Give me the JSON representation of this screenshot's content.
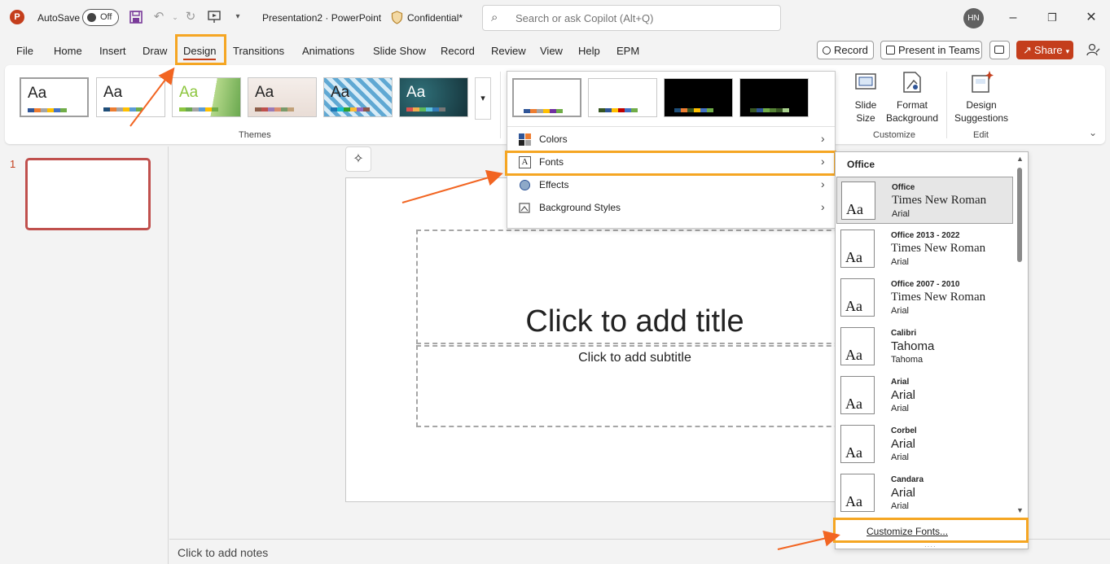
{
  "titlebar": {
    "app_logo": "P",
    "autosave_label": "AutoSave",
    "autosave_state": "Off",
    "document_title": "Presentation2  ·  PowerPoint",
    "sensitivity_label": "Confidential*",
    "search_placeholder": "Search or ask Copilot (Alt+Q)",
    "user_initials": "HN",
    "icons": [
      "save-icon",
      "undo-icon",
      "redo-icon",
      "present-icon",
      "customize-qat-icon",
      "minimize-icon",
      "restore-icon",
      "close-icon"
    ]
  },
  "menu": {
    "tabs": [
      "File",
      "Home",
      "Insert",
      "Draw",
      "Design",
      "Transitions",
      "Animations",
      "Slide Show",
      "Record",
      "Review",
      "View",
      "Help",
      "EPM"
    ],
    "active_tab": "Design",
    "record_button": "Record",
    "present_teams_button": "Present in Teams",
    "share_button": "Share"
  },
  "ribbon": {
    "themes_group_label": "Themes",
    "themes": [
      {
        "label": "Aa",
        "swatches": [
          "#2f5597",
          "#ed7d31",
          "#a5a5a5",
          "#ffc000",
          "#4472c4",
          "#70ad47"
        ]
      },
      {
        "label": "Aa",
        "swatches": [
          "#1f4e79",
          "#ed7d31",
          "#a5a5a5",
          "#ffc000",
          "#5b9bd5",
          "#70ad47"
        ]
      },
      {
        "label": "Aa",
        "swatches": [
          "#8dc63f",
          "#6aa84f",
          "#a5a5a5",
          "#5b9bd5",
          "#ffc000",
          "#70ad47"
        ]
      },
      {
        "label": "Aa",
        "swatches": [
          "#8e5f4a",
          "#c0504d",
          "#9b7bb8",
          "#d98d6f",
          "#7a9a6a",
          "#c1a078"
        ]
      },
      {
        "label": "Aa",
        "swatches": [
          "#1f77b4",
          "#17becf",
          "#2ca02c",
          "#ffbb33",
          "#9467bd",
          "#8c564b"
        ]
      },
      {
        "label": "Aa",
        "swatches": [
          "#d9534f",
          "#f0ad4e",
          "#5cb85c",
          "#5bc0de",
          "#337ab7",
          "#777777"
        ]
      }
    ],
    "customize_group_label": "Customize",
    "slide_size_label": "Slide Size",
    "format_background_label": "Format Background",
    "edit_group_label": "Edit",
    "design_suggestions_label": "Design Suggestions"
  },
  "variants_menu": {
    "variants": [
      {
        "bg": "#ffffff",
        "swatches": [
          "#2f5597",
          "#ed7d31",
          "#a5a5a5",
          "#ffc000",
          "#7030a0",
          "#70ad47"
        ]
      },
      {
        "bg": "#ffffff",
        "swatches": [
          "#375623",
          "#2f5597",
          "#ffc000",
          "#c00000",
          "#4472c4",
          "#70ad47"
        ]
      },
      {
        "bg": "#000000",
        "swatches": [
          "#1f4e79",
          "#ed7d31",
          "#375623",
          "#ffc000",
          "#4472c4",
          "#70ad47"
        ]
      },
      {
        "bg": "#000000",
        "swatches": [
          "#375623",
          "#2f5597",
          "#70ad47",
          "#548235",
          "#385723",
          "#a9d18e"
        ]
      }
    ],
    "items": [
      {
        "label": "Colors",
        "icon": "colors-icon"
      },
      {
        "label": "Fonts",
        "icon": "fonts-icon"
      },
      {
        "label": "Effects",
        "icon": "effects-icon"
      },
      {
        "label": "Background Styles",
        "icon": "background-styles-icon"
      }
    ]
  },
  "slide": {
    "number": "1",
    "title_placeholder": "Click to add title",
    "subtitle_placeholder": "Click to add subtitle",
    "notes_placeholder": "Click to add notes"
  },
  "fonts_gallery": {
    "header": "Office",
    "preview_text": "Aa",
    "entries": [
      {
        "name": "Office",
        "heading": "Times New Roman",
        "body": "Arial",
        "heading_family": "serif"
      },
      {
        "name": "Office 2013 - 2022",
        "heading": "Times New Roman",
        "body": "Arial",
        "heading_family": "serif"
      },
      {
        "name": "Office 2007 - 2010",
        "heading": "Times New Roman",
        "body": "Arial",
        "heading_family": "serif"
      },
      {
        "name": "Calibri",
        "heading": "Tahoma",
        "body": "Tahoma",
        "heading_family": "sans"
      },
      {
        "name": "Arial",
        "heading": "Arial",
        "body": "Arial",
        "heading_family": "sans"
      },
      {
        "name": "Corbel",
        "heading": "Arial",
        "body": "Arial",
        "heading_family": "sans"
      },
      {
        "name": "Candara",
        "heading": "Arial",
        "body": "Arial",
        "heading_family": "sans"
      }
    ],
    "customize_label": "Customize Fonts..."
  },
  "colors": {
    "accent": "#c43e1c",
    "highlight": "#f5a623",
    "arrow": "#f26522"
  }
}
